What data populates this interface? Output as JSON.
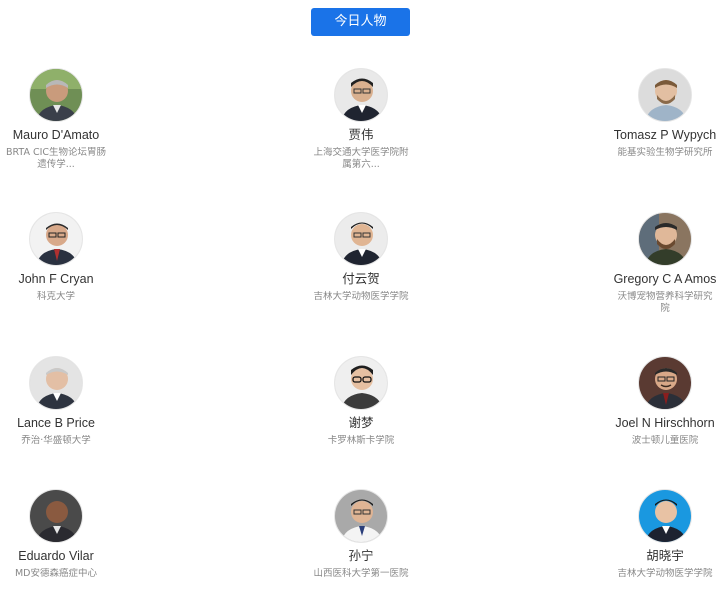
{
  "header": {
    "button_label": "今日人物"
  },
  "people": [
    {
      "name": "Mauro D'Amato",
      "org": "BRTA CIC生物论坛胃肠遗传学..."
    },
    {
      "name": "贾伟",
      "org": "上海交通大学医学院附属第六..."
    },
    {
      "name": "Tomasz P Wypych",
      "org": "能基实验生物学研究所"
    },
    {
      "name": "John F Cryan",
      "org": "科克大学"
    },
    {
      "name": "付云贺",
      "org": "吉林大学动物医学学院"
    },
    {
      "name": "Gregory C A Amos",
      "org": "沃博宠物营养科学研究院"
    },
    {
      "name": "Lance B Price",
      "org": "乔治·华盛顿大学"
    },
    {
      "name": "谢梦",
      "org": "卡罗林斯卡学院"
    },
    {
      "name": "Joel N Hirschhorn",
      "org": "波士顿儿童医院"
    },
    {
      "name": "Eduardo Vilar",
      "org": "MD安德森癌症中心"
    },
    {
      "name": "孙宁",
      "org": "山西医科大学第一医院"
    },
    {
      "name": "胡晓宇",
      "org": "吉林大学动物医学学院"
    }
  ]
}
